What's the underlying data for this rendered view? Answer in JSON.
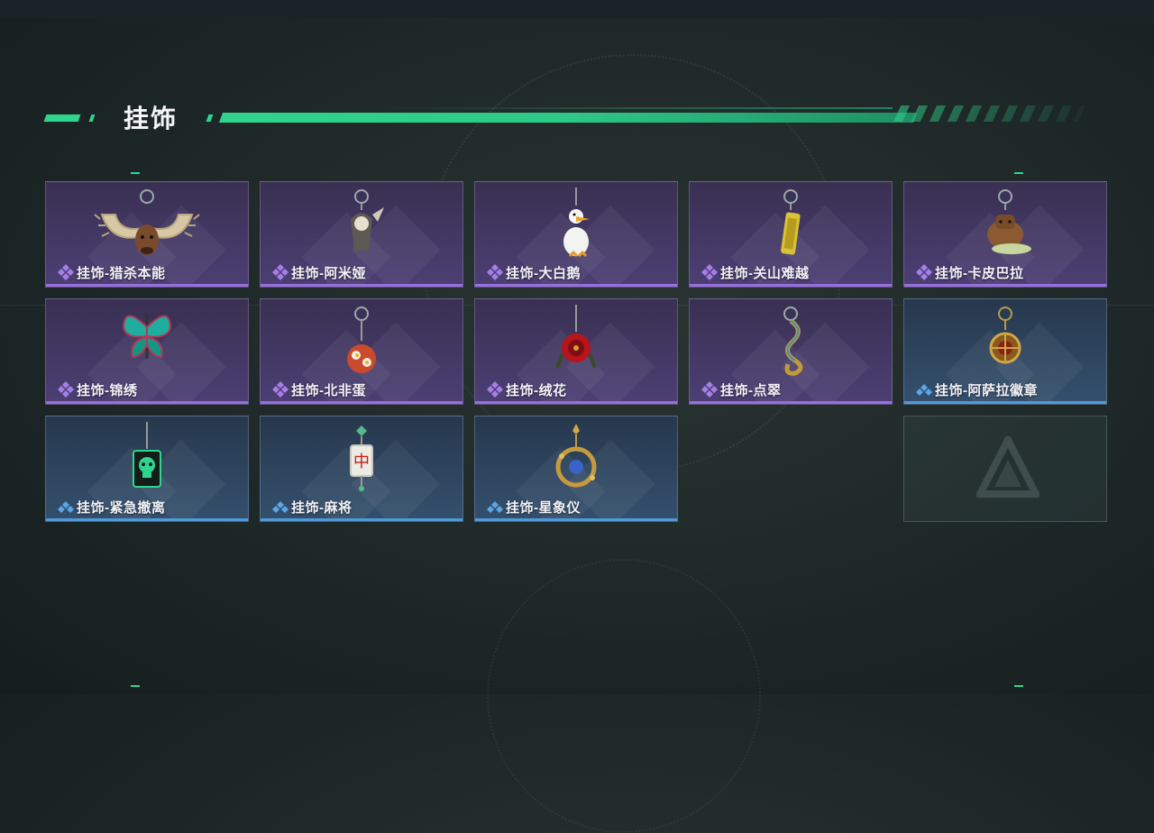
{
  "section": {
    "title": "挂饰"
  },
  "colors": {
    "accent": "#2fd58e",
    "purple_rarity": "#9a6ee0",
    "blue_rarity": "#4f9ad8"
  },
  "items": [
    {
      "name": "挂饰-猎杀本能",
      "rarity": "purple",
      "icon": "moose-antler-charm-icon"
    },
    {
      "name": "挂饰-阿米娅",
      "rarity": "purple",
      "icon": "doll-charm-icon"
    },
    {
      "name": "挂饰-大白鹅",
      "rarity": "purple",
      "icon": "goose-charm-icon"
    },
    {
      "name": "挂饰-关山难越",
      "rarity": "purple",
      "icon": "gold-bar-charm-icon"
    },
    {
      "name": "挂饰-卡皮巴拉",
      "rarity": "purple",
      "icon": "capybara-charm-icon"
    },
    {
      "name": "挂饰-锦绣",
      "rarity": "purple",
      "icon": "butterfly-charm-icon"
    },
    {
      "name": "挂饰-北非蛋",
      "rarity": "purple",
      "icon": "shakshuka-charm-icon"
    },
    {
      "name": "挂饰-绒花",
      "rarity": "purple",
      "icon": "red-flower-charm-icon"
    },
    {
      "name": "挂饰-点翠",
      "rarity": "purple",
      "icon": "phoenix-charm-icon"
    },
    {
      "name": "挂饰-阿萨拉徽章",
      "rarity": "blue",
      "icon": "badge-charm-icon"
    },
    {
      "name": "挂饰-紧急撤离",
      "rarity": "blue",
      "icon": "skull-tag-charm-icon"
    },
    {
      "name": "挂饰-麻将",
      "rarity": "blue",
      "icon": "mahjong-charm-icon"
    },
    {
      "name": "挂饰-星象仪",
      "rarity": "blue",
      "icon": "astrolabe-charm-icon"
    }
  ],
  "empty_slot": {
    "icon": "game-logo-icon"
  }
}
